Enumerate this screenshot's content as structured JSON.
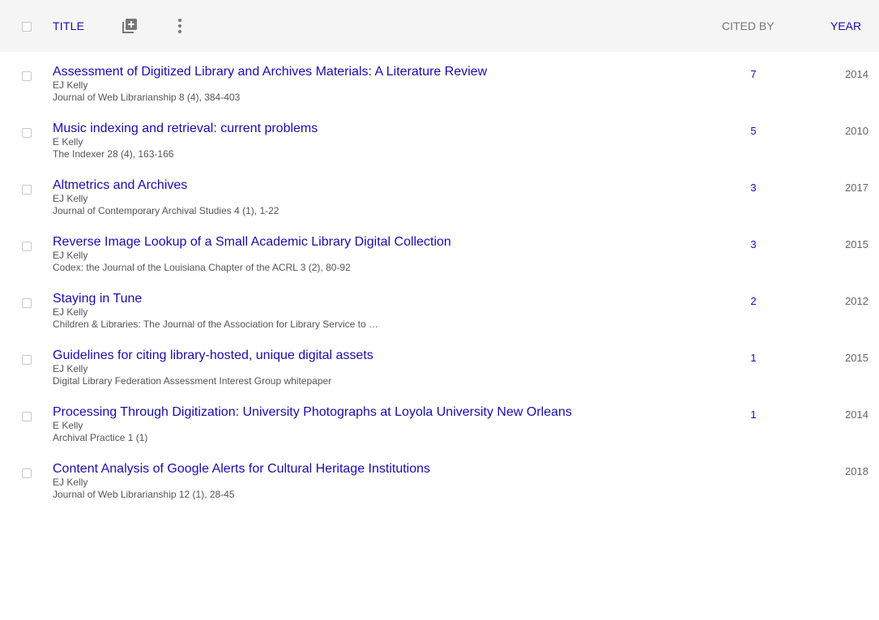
{
  "header": {
    "title_label": "TITLE",
    "add_icon": "add-box-icon",
    "more_icon": "more-vert-icon",
    "cited_by_label": "CITED BY",
    "year_label": "YEAR"
  },
  "colors": {
    "link": "#1a0dab",
    "header_bg": "#f5f5f5",
    "muted": "#555555"
  },
  "articles": [
    {
      "title": "Assessment of Digitized Library and Archives Materials: A Literature Review",
      "authors": "EJ Kelly",
      "venue": "Journal of Web Librarianship 8 (4), 384-403",
      "cited_by": "7",
      "year": "2014"
    },
    {
      "title": "Music indexing and retrieval: current problems",
      "authors": "E Kelly",
      "venue": "The Indexer 28 (4), 163-166",
      "cited_by": "5",
      "year": "2010"
    },
    {
      "title": "Altmetrics and Archives",
      "authors": "EJ Kelly",
      "venue": "Journal of Contemporary Archival Studies 4 (1), 1-22",
      "cited_by": "3",
      "year": "2017"
    },
    {
      "title": "Reverse Image Lookup of a Small Academic Library Digital Collection",
      "authors": "EJ Kelly",
      "venue": "Codex: the Journal of the Louisiana Chapter of the ACRL 3 (2), 80-92",
      "cited_by": "3",
      "year": "2015"
    },
    {
      "title": "Staying in Tune",
      "authors": "EJ Kelly",
      "venue": "Children & Libraries: The Journal of the Association for Library Service to …",
      "cited_by": "2",
      "year": "2012"
    },
    {
      "title": "Guidelines for citing library-hosted, unique digital assets",
      "authors": "EJ Kelly",
      "venue": "Digital Library Federation Assessment Interest Group whitepaper",
      "cited_by": "1",
      "year": "2015"
    },
    {
      "title": "Processing Through Digitization: University Photographs at Loyola University New Orleans",
      "authors": "E Kelly",
      "venue": "Archival Practice 1 (1)",
      "cited_by": "1",
      "year": "2014"
    },
    {
      "title": "Content Analysis of Google Alerts for Cultural Heritage Institutions",
      "authors": "EJ Kelly",
      "venue": "Journal of Web Librarianship 12 (1), 28-45",
      "cited_by": "",
      "year": "2018"
    }
  ]
}
